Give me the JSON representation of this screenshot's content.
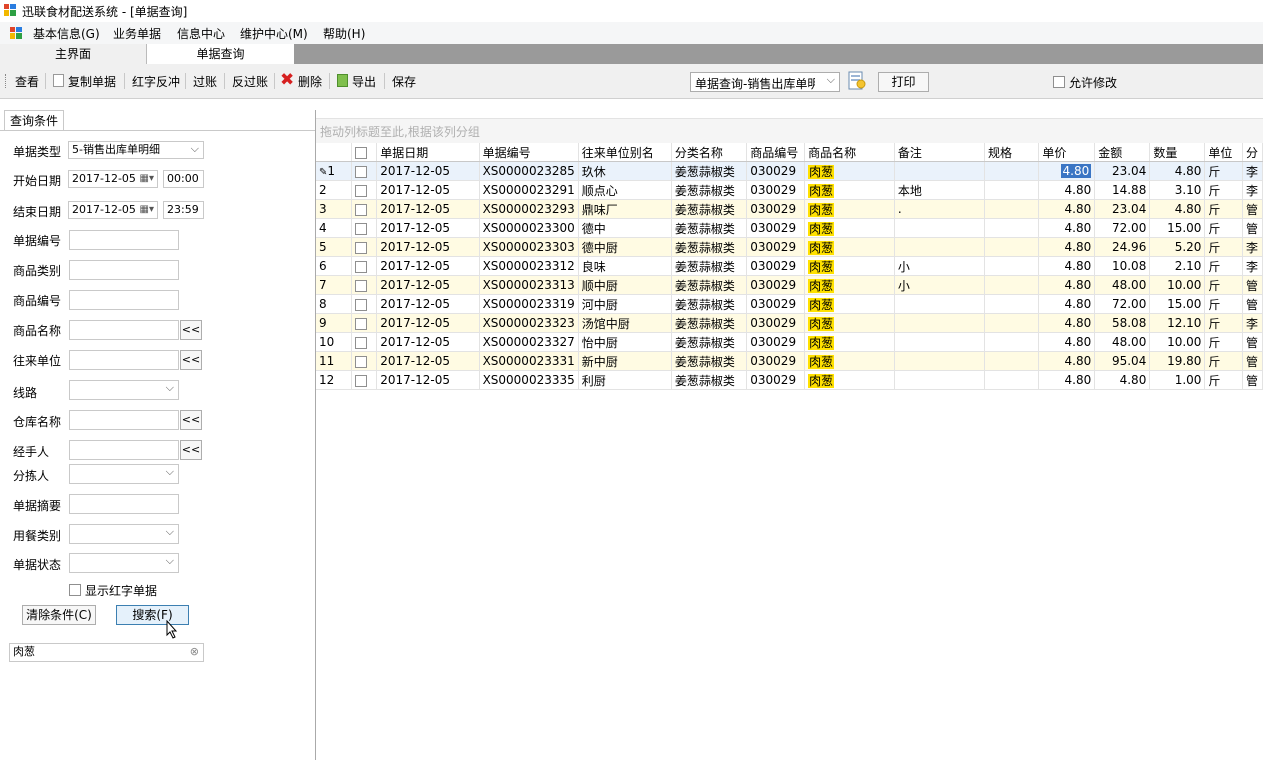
{
  "window": {
    "title": "迅联食材配送系统 - [单据查询]"
  },
  "menu": {
    "items": [
      "基本信息(G)",
      "业务单据",
      "信息中心",
      "维护中心(M)",
      "帮助(H)"
    ]
  },
  "doc_tabs": [
    "主界面",
    "单据查询"
  ],
  "toolbar": {
    "buttons": [
      "查看",
      "复制单据",
      "红字反冲",
      "过账",
      "反过账",
      "删除",
      "导出",
      "保存"
    ],
    "report_select": "单据查询-销售出库单明细",
    "print_label": "打印",
    "allow_edit_label": "允许修改"
  },
  "left": {
    "tab": "查询条件",
    "fields": {
      "doc_type_label": "单据类型",
      "doc_type_value": "5-销售出库单明细",
      "start_date_label": "开始日期",
      "start_date": "2017-12-05",
      "start_time": "00:00",
      "end_date_label": "结束日期",
      "end_date": "2017-12-05",
      "end_time": "23:59",
      "doc_no_label": "单据编号",
      "goods_cat_label": "商品类别",
      "goods_no_label": "商品编号",
      "goods_name_label": "商品名称",
      "partner_label": "往来单位",
      "route_label": "线路",
      "warehouse_label": "仓库名称",
      "handler_label": "经手人",
      "picker_label": "分拣人",
      "summary_label": "单据摘要",
      "meal_label": "用餐类别",
      "status_label": "单据状态",
      "show_red_label": "显示红字单据"
    },
    "clear_btn": "清除条件(C)",
    "search_btn": "搜索(F)",
    "search_text": "肉葱",
    "more_btn": "<<"
  },
  "grid": {
    "group_hint": "拖动列标题至此,根据该列分组",
    "columns": [
      "单据日期",
      "单据编号",
      "往来单位别名",
      "分类名称",
      "商品编号",
      "商品名称",
      "备注",
      "规格",
      "单价",
      "金额",
      "数量",
      "单位",
      "分"
    ],
    "rows": [
      {
        "n": "1",
        "date": "2017-12-05",
        "no": "XS0000023285",
        "partner": "玖休",
        "cat": "姜葱蒜椒类",
        "code": "030029",
        "name": "肉葱",
        "note": "",
        "spec": "",
        "price": "4.80",
        "amount": "23.04",
        "qty": "4.80",
        "unit": "斤",
        "more": "李"
      },
      {
        "n": "2",
        "date": "2017-12-05",
        "no": "XS0000023291",
        "partner": "顺点心",
        "cat": "姜葱蒜椒类",
        "code": "030029",
        "name": "肉葱",
        "note": "本地",
        "spec": "",
        "price": "4.80",
        "amount": "14.88",
        "qty": "3.10",
        "unit": "斤",
        "more": "李"
      },
      {
        "n": "3",
        "date": "2017-12-05",
        "no": "XS0000023293",
        "partner": "鼎味厂",
        "cat": "姜葱蒜椒类",
        "code": "030029",
        "name": "肉葱",
        "note": ".",
        "spec": "",
        "price": "4.80",
        "amount": "23.04",
        "qty": "4.80",
        "unit": "斤",
        "more": "管"
      },
      {
        "n": "4",
        "date": "2017-12-05",
        "no": "XS0000023300",
        "partner": "德中",
        "cat": "姜葱蒜椒类",
        "code": "030029",
        "name": "肉葱",
        "note": "",
        "spec": "",
        "price": "4.80",
        "amount": "72.00",
        "qty": "15.00",
        "unit": "斤",
        "more": "管"
      },
      {
        "n": "5",
        "date": "2017-12-05",
        "no": "XS0000023303",
        "partner": "德中厨",
        "cat": "姜葱蒜椒类",
        "code": "030029",
        "name": "肉葱",
        "note": "",
        "spec": "",
        "price": "4.80",
        "amount": "24.96",
        "qty": "5.20",
        "unit": "斤",
        "more": "李"
      },
      {
        "n": "6",
        "date": "2017-12-05",
        "no": "XS0000023312",
        "partner": "良味",
        "cat": "姜葱蒜椒类",
        "code": "030029",
        "name": "肉葱",
        "note": "小",
        "spec": "",
        "price": "4.80",
        "amount": "10.08",
        "qty": "2.10",
        "unit": "斤",
        "more": "李"
      },
      {
        "n": "7",
        "date": "2017-12-05",
        "no": "XS0000023313",
        "partner": "顺中厨",
        "cat": "姜葱蒜椒类",
        "code": "030029",
        "name": "肉葱",
        "note": "小",
        "spec": "",
        "price": "4.80",
        "amount": "48.00",
        "qty": "10.00",
        "unit": "斤",
        "more": "管"
      },
      {
        "n": "8",
        "date": "2017-12-05",
        "no": "XS0000023319",
        "partner": "河中厨",
        "cat": "姜葱蒜椒类",
        "code": "030029",
        "name": "肉葱",
        "note": "",
        "spec": "",
        "price": "4.80",
        "amount": "72.00",
        "qty": "15.00",
        "unit": "斤",
        "more": "管"
      },
      {
        "n": "9",
        "date": "2017-12-05",
        "no": "XS0000023323",
        "partner": "汤馆中厨",
        "cat": "姜葱蒜椒类",
        "code": "030029",
        "name": "肉葱",
        "note": "",
        "spec": "",
        "price": "4.80",
        "amount": "58.08",
        "qty": "12.10",
        "unit": "斤",
        "more": "李"
      },
      {
        "n": "10",
        "date": "2017-12-05",
        "no": "XS0000023327",
        "partner": "怡中厨",
        "cat": "姜葱蒜椒类",
        "code": "030029",
        "name": "肉葱",
        "note": "",
        "spec": "",
        "price": "4.80",
        "amount": "48.00",
        "qty": "10.00",
        "unit": "斤",
        "more": "管"
      },
      {
        "n": "11",
        "date": "2017-12-05",
        "no": "XS0000023331",
        "partner": "新中厨",
        "cat": "姜葱蒜椒类",
        "code": "030029",
        "name": "肉葱",
        "note": "",
        "spec": "",
        "price": "4.80",
        "amount": "95.04",
        "qty": "19.80",
        "unit": "斤",
        "more": "管"
      },
      {
        "n": "12",
        "date": "2017-12-05",
        "no": "XS0000023335",
        "partner": "利厨",
        "cat": "姜葱蒜椒类",
        "code": "030029",
        "name": "肉葱",
        "note": "",
        "spec": "",
        "price": "4.80",
        "amount": "4.80",
        "qty": "1.00",
        "unit": "斤",
        "more": "管"
      }
    ]
  },
  "colors": {
    "highlight": "#ffe100",
    "odd_row": "#fffbe3",
    "selected_cell": "#3a75c4"
  }
}
